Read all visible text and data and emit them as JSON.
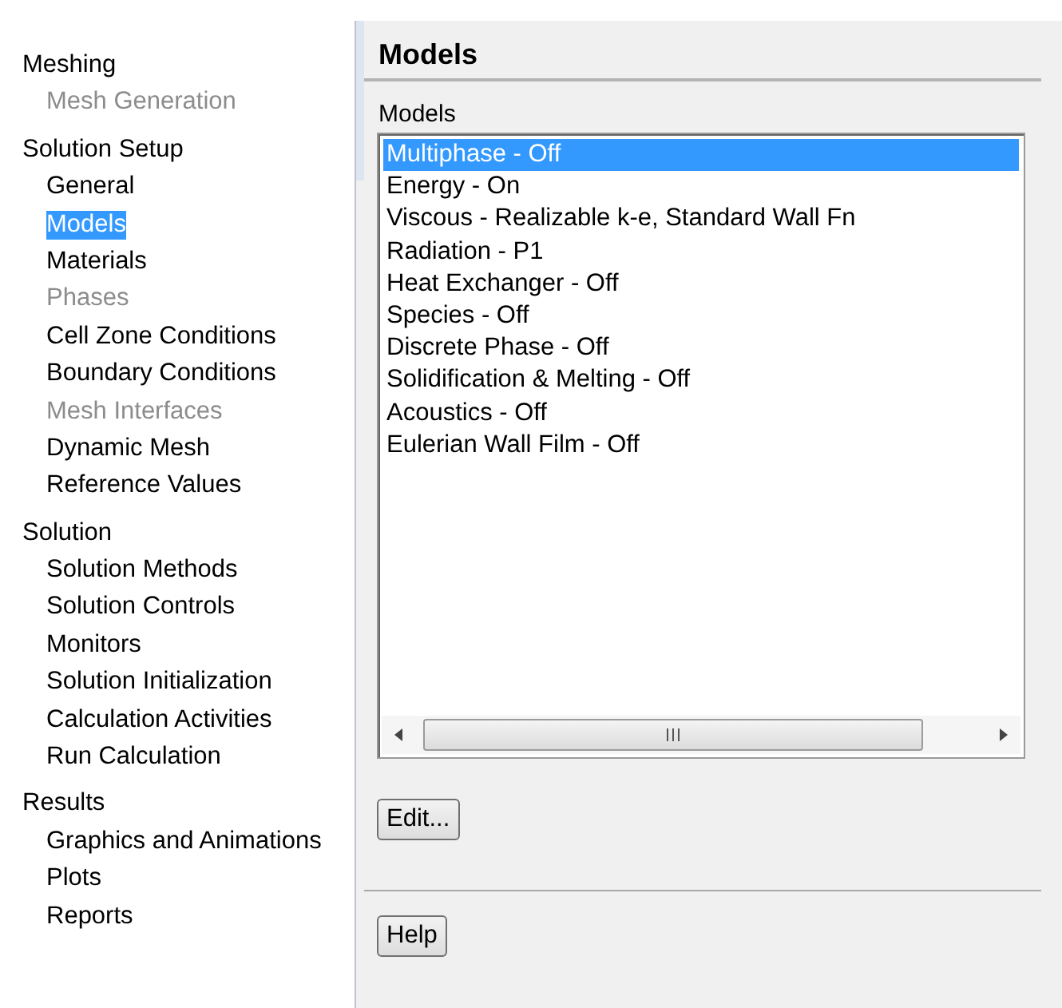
{
  "sidebar": {
    "sections": [
      {
        "label": "Meshing",
        "selected": false,
        "disabled": false,
        "children": [
          {
            "label": "Mesh Generation",
            "selected": false,
            "disabled": true
          }
        ]
      },
      {
        "label": "Solution Setup",
        "selected": false,
        "disabled": false,
        "children": [
          {
            "label": "General",
            "selected": false,
            "disabled": false
          },
          {
            "label": "Models",
            "selected": true,
            "disabled": false
          },
          {
            "label": "Materials",
            "selected": false,
            "disabled": false
          },
          {
            "label": "Phases",
            "selected": false,
            "disabled": true
          },
          {
            "label": "Cell Zone Conditions",
            "selected": false,
            "disabled": false
          },
          {
            "label": "Boundary Conditions",
            "selected": false,
            "disabled": false
          },
          {
            "label": "Mesh Interfaces",
            "selected": false,
            "disabled": true
          },
          {
            "label": "Dynamic Mesh",
            "selected": false,
            "disabled": false
          },
          {
            "label": "Reference Values",
            "selected": false,
            "disabled": false
          }
        ]
      },
      {
        "label": "Solution",
        "selected": false,
        "disabled": false,
        "children": [
          {
            "label": "Solution Methods",
            "selected": false,
            "disabled": false
          },
          {
            "label": "Solution Controls",
            "selected": false,
            "disabled": false
          },
          {
            "label": "Monitors",
            "selected": false,
            "disabled": false
          },
          {
            "label": "Solution Initialization",
            "selected": false,
            "disabled": false
          },
          {
            "label": "Calculation Activities",
            "selected": false,
            "disabled": false
          },
          {
            "label": "Run Calculation",
            "selected": false,
            "disabled": false
          }
        ]
      },
      {
        "label": "Results",
        "selected": false,
        "disabled": false,
        "children": [
          {
            "label": "Graphics and Animations",
            "selected": false,
            "disabled": false
          },
          {
            "label": "Plots",
            "selected": false,
            "disabled": false
          },
          {
            "label": "Reports",
            "selected": false,
            "disabled": false
          }
        ]
      }
    ]
  },
  "panel": {
    "title": "Models",
    "list_label": "Models",
    "models": [
      {
        "label": "Multiphase - Off",
        "selected": true
      },
      {
        "label": "Energy - On",
        "selected": false
      },
      {
        "label": "Viscous - Realizable k-e, Standard Wall Fn",
        "selected": false
      },
      {
        "label": "Radiation - P1",
        "selected": false
      },
      {
        "label": "Heat Exchanger - Off",
        "selected": false
      },
      {
        "label": "Species - Off",
        "selected": false
      },
      {
        "label": "Discrete Phase - Off",
        "selected": false
      },
      {
        "label": "Solidification & Melting - Off",
        "selected": false
      },
      {
        "label": "Acoustics - Off",
        "selected": false
      },
      {
        "label": "Eulerian Wall Film - Off",
        "selected": false
      }
    ],
    "edit_button": "Edit...",
    "help_button": "Help"
  }
}
